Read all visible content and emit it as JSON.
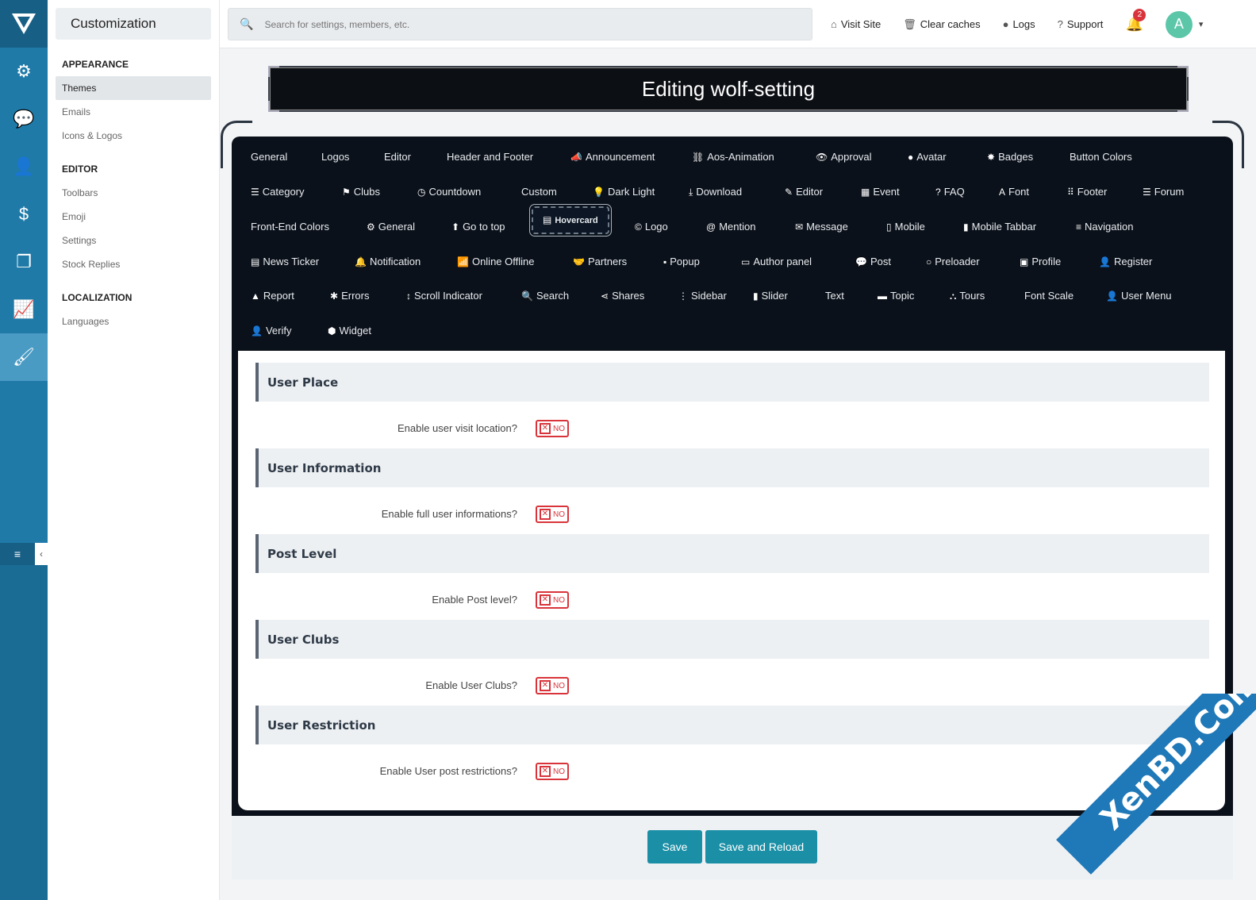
{
  "sidebar": {
    "title": "Customization",
    "sections": [
      {
        "heading": "APPEARANCE",
        "items": [
          "Themes",
          "Emails",
          "Icons & Logos"
        ]
      },
      {
        "heading": "EDITOR",
        "items": [
          "Toolbars",
          "Emoji",
          "Settings",
          "Stock Replies"
        ]
      },
      {
        "heading": "LOCALIZATION",
        "items": [
          "Languages"
        ]
      }
    ],
    "active_item": "Themes"
  },
  "search": {
    "placeholder": "Search for settings, members, etc."
  },
  "topbar": {
    "links": [
      "Visit Site",
      "Clear caches",
      "Logs",
      "Support"
    ],
    "notifications_count": "2",
    "avatar_letter": "A"
  },
  "page": {
    "title": "Editing wolf-setting"
  },
  "tabs": {
    "row1": [
      "General",
      "Logos",
      "Editor",
      "Header and Footer",
      "Announcement",
      "Aos-Animation",
      "Approval",
      "Avatar",
      "Badges",
      "Button Colors"
    ],
    "row2": [
      "Category",
      "Clubs",
      "Countdown",
      "Custom",
      "Dark Light",
      "Download",
      "Editor",
      "Event",
      "FAQ",
      "Font",
      "Footer",
      "Forum"
    ],
    "row3": [
      "Front-End Colors",
      "General",
      "Go to top",
      "Hovercard",
      "Logo",
      "Mention",
      "Message",
      "Mobile",
      "Mobile Tabbar",
      "Navigation"
    ],
    "row4": [
      "News Ticker",
      "Notification",
      "Online Offline",
      "Partners",
      "Popup",
      "Author panel",
      "Post",
      "Preloader",
      "Profile",
      "Register"
    ],
    "row5": [
      "Report",
      "Errors",
      "Scroll Indicator",
      "Search",
      "Shares",
      "Sidebar",
      "Slider",
      "Text",
      "Topic",
      "Tours",
      "Font Scale",
      "User Menu"
    ],
    "row6": [
      "Verify",
      "Widget"
    ],
    "active": "Hovercard"
  },
  "sections": [
    {
      "title": "User Place",
      "option_label": "Enable user visit location?",
      "value": "NO"
    },
    {
      "title": "User Information",
      "option_label": "Enable full user informations?",
      "value": "NO"
    },
    {
      "title": "Post Level",
      "option_label": "Enable Post level?",
      "value": "NO"
    },
    {
      "title": "User Clubs",
      "option_label": "Enable User Clubs?",
      "value": "NO"
    },
    {
      "title": "User Restriction",
      "option_label": "Enable User post restrictions?",
      "value": "NO"
    }
  ],
  "buttons": {
    "save": "Save",
    "save_reload": "Save and Reload"
  },
  "watermark": {
    "corner_text": "XenBD.Com"
  },
  "colors": {
    "accent": "#1a8fa6",
    "rail": "#1f7aa8",
    "danger": "#d9343b",
    "panel_dark": "#0b111a"
  }
}
